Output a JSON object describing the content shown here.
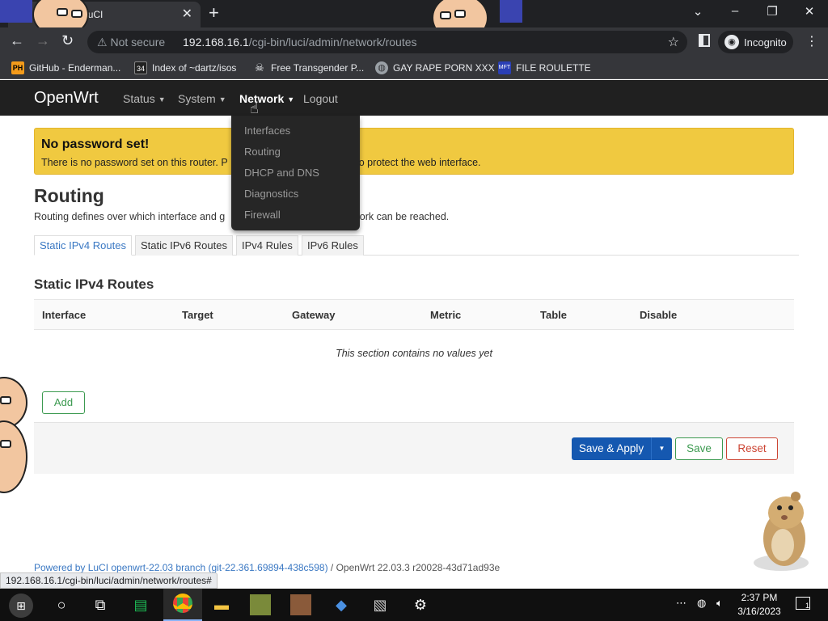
{
  "browser": {
    "tab_title": "Routing - LuCI",
    "new_tab_icon": "plus-icon",
    "omnibox": {
      "security_label": "Not secure",
      "url_host": "192.168.16.1",
      "url_path": "/cgi-bin/luci/admin/network/routes"
    },
    "profile_label": "Incognito",
    "bookmarks": [
      {
        "label": "GitHub - Enderman...",
        "icon": "PH"
      },
      {
        "label": "Index of ~dartz/isos",
        "icon": "34"
      },
      {
        "label": "Free Transgender P...",
        "icon": "skull"
      },
      {
        "label": "GAY RAPE PORN XXX",
        "icon": "globe"
      },
      {
        "label": "FILE ROULETTE",
        "icon": "MFT"
      }
    ],
    "status_url": "192.168.16.1/cgi-bin/luci/admin/network/routes#"
  },
  "luci": {
    "brand": "OpenWrt",
    "menu": [
      {
        "label": "Status"
      },
      {
        "label": "System"
      },
      {
        "label": "Network"
      },
      {
        "label": "Logout"
      }
    ],
    "network_dropdown": [
      "Interfaces",
      "Routing",
      "DHCP and DNS",
      "Diagnostics",
      "Firewall"
    ],
    "alert": {
      "title": "No password set!",
      "text_start": "There is no password set on this router. P",
      "text_end": "word to protect the web interface."
    },
    "page_title": "Routing",
    "page_desc_start": "Routing defines over which interface and g",
    "page_desc_end": "twork can be reached.",
    "tabs": [
      "Static IPv4 Routes",
      "Static IPv6 Routes",
      "IPv4 Rules",
      "IPv6 Rules"
    ],
    "section_title": "Static IPv4 Routes",
    "columns": [
      "Interface",
      "Target",
      "Gateway",
      "Metric",
      "Table",
      "Disable"
    ],
    "empty_text": "This section contains no values yet",
    "add_label": "Add",
    "save_apply_label": "Save & Apply",
    "save_label": "Save",
    "reset_label": "Reset",
    "footer": {
      "powered": "Powered by LuCI openwrt-22.03 branch (git-22.361.69894-438c598)",
      "version": " / OpenWrt 22.03.3 r20028-43d71ad93e"
    }
  },
  "taskbar": {
    "time": "2:37 PM",
    "date": "3/16/2023",
    "notification_count": "1"
  },
  "colors": {
    "luci_nav": "#202020",
    "alert": "#f0c940",
    "primary": "#1558b0",
    "positive": "#3c9a50",
    "negative": "#cc4433"
  }
}
